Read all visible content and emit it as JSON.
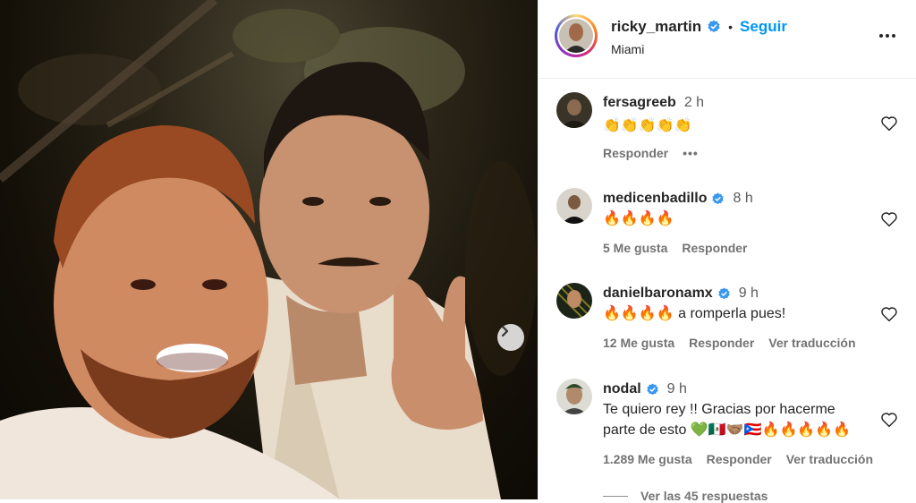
{
  "header": {
    "username": "ricky_martin",
    "separator": "•",
    "follow_label": "Seguir",
    "location": "Miami"
  },
  "comments": [
    {
      "username": "fersagreeb",
      "verified": false,
      "time": "2 h",
      "text": "👏👏👏👏👏",
      "likes": "",
      "reply": "Responder",
      "more": "•••",
      "translate": ""
    },
    {
      "username": "medicenbadillo",
      "verified": true,
      "time": "8 h",
      "text": "🔥🔥🔥🔥",
      "likes": "5 Me gusta",
      "reply": "Responder",
      "translate": ""
    },
    {
      "username": "danielbaronamx",
      "verified": true,
      "time": "9 h",
      "text": "🔥🔥🔥🔥 a romperla pues!",
      "likes": "12 Me gusta",
      "reply": "Responder",
      "translate": "Ver traducción"
    },
    {
      "username": "nodal",
      "verified": true,
      "time": "9 h",
      "text": "Te quiero rey !! Gracias por hacerme parte de esto 💚🇲🇽🤝🏽🇵🇷🔥🔥🔥🔥🔥",
      "likes": "1.289 Me gusta",
      "reply": "Responder",
      "translate": "Ver traducción"
    }
  ],
  "view_replies": "Ver las 45 respuestas",
  "colors": {
    "accent": "#0095f6",
    "verified": "#3897f0",
    "muted": "#737373"
  }
}
